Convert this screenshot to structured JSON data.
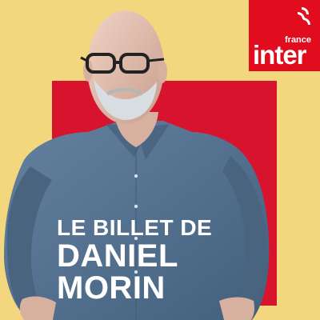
{
  "brand": {
    "small": "france",
    "big": "inter",
    "icon": "radio-logo-icon"
  },
  "cover": {
    "line1": "LE BILLET DE",
    "line2": "DANIEL",
    "line3": "MORIN"
  },
  "colors": {
    "background": "#f3d77e",
    "square": "#d7132e",
    "logo_red": "#e20c1f",
    "text": "#ffffff",
    "shirt": "#55708f"
  }
}
